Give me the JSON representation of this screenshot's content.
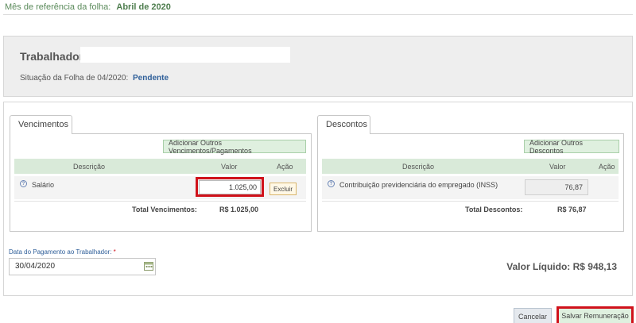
{
  "header": {
    "ref_label": "Mês de referência da folha:",
    "ref_value": "Abril de 2020"
  },
  "worker": {
    "label": "Trabalhador:",
    "name": "",
    "status_label": "Situação da Folha de 04/2020:",
    "status_value": "Pendente"
  },
  "vencimentos": {
    "tab": "Vencimentos",
    "add_button": "Adicionar Outros Vencimentos/Pagamentos",
    "columns": [
      "Descrição",
      "Valor",
      "Ação"
    ],
    "rows": [
      {
        "description": "Salário",
        "value": "1.025,00",
        "action": "Excluir"
      }
    ],
    "total_label": "Total Vencimentos:",
    "total_value": "R$ 1.025,00"
  },
  "descontos": {
    "tab": "Descontos",
    "add_button": "Adicionar Outros Descontos",
    "columns": [
      "Descrição",
      "Valor",
      "Ação"
    ],
    "rows": [
      {
        "description": "Contribuição previdenciária do empregado (INSS)",
        "value": "76,87"
      }
    ],
    "total_label": "Total Descontos:",
    "total_value": "R$ 76,87"
  },
  "payment": {
    "date_label": "Data do Pagamento ao Trabalhador:",
    "required_mark": "*",
    "date_value": "30/04/2020"
  },
  "net": {
    "label": "Valor Líquido:",
    "value": "R$ 948,13"
  },
  "actions": {
    "cancel": "Cancelar",
    "save": "Salvar Remuneração"
  },
  "colors": {
    "highlight": "#d0121b",
    "header_green": "#d9ead9",
    "link_blue": "#2f5f99"
  }
}
